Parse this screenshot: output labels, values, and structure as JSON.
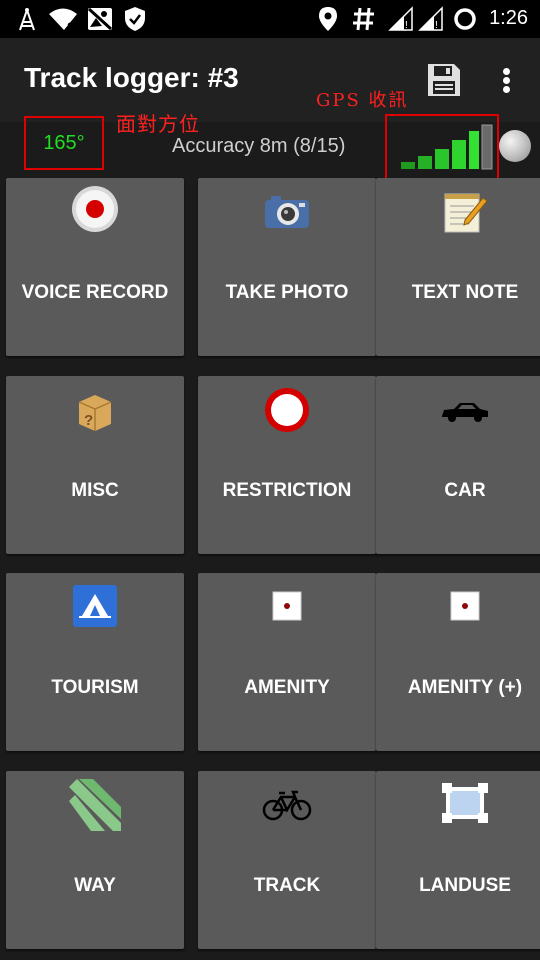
{
  "status_bar": {
    "time": "1:26",
    "icons": [
      "signal-tower-icon",
      "wifi-no-internet-icon",
      "no-image-icon",
      "shield-check-icon",
      "location-pin-icon",
      "hash-icon",
      "cell-signal-1-icon",
      "cell-signal-2-icon",
      "loading-ring-icon"
    ]
  },
  "app_bar": {
    "title": "Track logger: #3",
    "actions": [
      "save-icon",
      "overflow-menu-icon"
    ]
  },
  "info": {
    "bearing": "165°",
    "bearing_annotation": "面對方位",
    "accuracy": "Accuracy 8m (8/15)",
    "gps_annotation": "GPS 收訊",
    "signal_bars": 6,
    "signal_bars_active": 5,
    "colors": {
      "annotation": "#e00000",
      "bearing": "#22dd22",
      "signal": "#22bb22"
    }
  },
  "tiles": [
    {
      "label": "VOICE RECORD",
      "icon": "record-icon"
    },
    {
      "label": "TAKE PHOTO",
      "icon": "camera-icon"
    },
    {
      "label": "TEXT NOTE",
      "icon": "notepad-icon"
    },
    {
      "label": "MISC",
      "icon": "box-question-icon"
    },
    {
      "label": "RESTRICTION",
      "icon": "no-entry-icon"
    },
    {
      "label": "CAR",
      "icon": "car-icon"
    },
    {
      "label": "TOURISM",
      "icon": "tent-icon"
    },
    {
      "label": "AMENITY",
      "icon": "amenity-icon"
    },
    {
      "label": "AMENITY (+)",
      "icon": "amenity-plus-icon"
    },
    {
      "label": "WAY",
      "icon": "way-icon"
    },
    {
      "label": "TRACK",
      "icon": "bicycle-icon"
    },
    {
      "label": "LANDUSE",
      "icon": "landuse-icon"
    }
  ]
}
